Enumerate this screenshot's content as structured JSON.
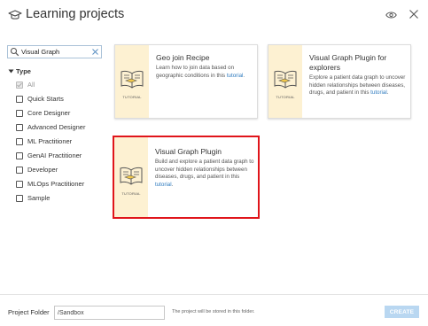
{
  "header": {
    "title": "Learning projects"
  },
  "search": {
    "value": "Visual Graph",
    "placeholder": ""
  },
  "filters": {
    "heading": "Type",
    "items": [
      {
        "label": "All",
        "checked": true,
        "disabled": true
      },
      {
        "label": "Quick Starts",
        "checked": false,
        "disabled": false
      },
      {
        "label": "Core Designer",
        "checked": false,
        "disabled": false
      },
      {
        "label": "Advanced Designer",
        "checked": false,
        "disabled": false
      },
      {
        "label": "ML Practitioner",
        "checked": false,
        "disabled": false
      },
      {
        "label": "GenAI Practitioner",
        "checked": false,
        "disabled": false
      },
      {
        "label": "Developer",
        "checked": false,
        "disabled": false
      },
      {
        "label": "MLOps Practitioner",
        "checked": false,
        "disabled": false
      },
      {
        "label": "Sample",
        "checked": false,
        "disabled": false
      }
    ]
  },
  "cards": [
    {
      "title": "Geo join Recipe",
      "desc": "Learn how to join data based on geographic conditions in this",
      "link": "tutorial",
      "tail": ".",
      "badge": "TUTORIAL",
      "selected": false
    },
    {
      "title": "Visual Graph Plugin for explorers",
      "desc": "Explore a patient data graph to uncover hidden relationships between diseases, drugs, and patient in this",
      "link": "tutorial",
      "tail": ".",
      "badge": "TUTORIAL",
      "selected": false
    },
    {
      "title": "Visual Graph Plugin",
      "desc": "Build and explore a patient data graph to uncover hidden relationships between diseases, drugs, and patient in this",
      "link": "tutorial",
      "tail": ".",
      "badge": "TUTORIAL",
      "selected": true
    }
  ],
  "footer": {
    "label": "Project Folder",
    "folder_value": "/Sandbox",
    "hint": "The project will be stored in this folder.",
    "create_label": "CREATE"
  },
  "colors": {
    "accent": "#2f7bbf",
    "selection": "#e0151b",
    "card_strip": "#fdf1d2",
    "create_disabled": "#b9d7f1"
  }
}
